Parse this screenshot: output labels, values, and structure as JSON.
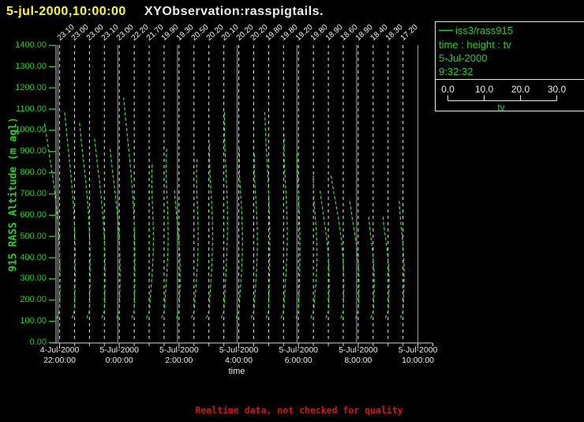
{
  "title": {
    "timestamp": "5-jul-2000,10:00:00",
    "window_name": "XYObservation:rasspigtails."
  },
  "legend": {
    "series_label": "iss3/rass915",
    "fields_label": "time : height : tv",
    "date": "5-Jul-2000",
    "time": "9:32:32",
    "scale": {
      "tick_labels": [
        "0.0",
        "10.0",
        "20.0",
        "30.0"
      ],
      "label": "tv"
    }
  },
  "y_axis": {
    "label": "915 RASS Altitude (m agl)",
    "tick_labels": [
      "1400.00",
      "1300.00",
      "1200.00",
      "1100.00",
      "1000.00",
      "900.00",
      "800.00",
      "700.00",
      "600.00",
      "500.00",
      "400.00",
      "300.00",
      "200.00",
      "100.00",
      "0.00"
    ]
  },
  "x_axis": {
    "label": "time",
    "major_ticks": [
      {
        "date": "4-Jul-2000",
        "time": "22:00:00"
      },
      {
        "date": "5-Jul-2000",
        "time": "0:00:00"
      },
      {
        "date": "5-Jul-2000",
        "time": "2:00:00"
      },
      {
        "date": "5-Jul-2000",
        "time": "4:00:00"
      },
      {
        "date": "5-Jul-2000",
        "time": "6:00:00"
      },
      {
        "date": "5-Jul-2000",
        "time": "8:00:00"
      },
      {
        "date": "5-Jul-2000",
        "time": "10:00:00"
      }
    ]
  },
  "footer": {
    "warning": "Realtime data, not checked for quality"
  },
  "colors": {
    "background": "#000000",
    "title_yellow": "#ffff00",
    "text_white": "#ededed",
    "text_green": "#1fd41f",
    "curve_green": "#33e633",
    "grid_dashed": "#e8e8e8",
    "grid_solid": "#a0a0a0",
    "axis": "#d8d8d8",
    "warning_red": "#e01212"
  },
  "chart_data": {
    "type": "line",
    "title": "RASS virtual temperature pigtail profiles, one per 30 minutes",
    "xlabel": "time",
    "ylabel": "915 RASS Altitude (m agl)",
    "x_range": [
      "4-Jul-2000 22:00:00",
      "5-Jul-2000 10:00:00"
    ],
    "ylim_m": [
      0,
      1400
    ],
    "tv_scale_range": [
      0.0,
      30.0
    ],
    "profile_interval_min": 30,
    "lowest_gate_m": 115,
    "profiles": [
      {
        "time": "22:00",
        "surface_tv": 23.1,
        "top_alt_m": 1050,
        "tv_lean_at_top": -4.3
      },
      {
        "time": "22:30",
        "surface_tv": 23.0,
        "top_alt_m": 1100,
        "tv_lean_at_top": -2.8
      },
      {
        "time": "23:00",
        "surface_tv": 23.0,
        "top_alt_m": 1045,
        "tv_lean_at_top": -2.8
      },
      {
        "time": "23:30",
        "surface_tv": 23.1,
        "top_alt_m": 975,
        "tv_lean_at_top": -2.8
      },
      {
        "time": "0:00",
        "surface_tv": 23.0,
        "top_alt_m": 920,
        "tv_lean_at_top": -2.6
      },
      {
        "time": "0:30",
        "surface_tv": 22.2,
        "top_alt_m": 1165,
        "tv_lean_at_top": -3.0
      },
      {
        "time": "1:00",
        "surface_tv": 21.7,
        "top_alt_m": 865,
        "tv_lean_at_top": 0.9
      },
      {
        "time": "1:30",
        "surface_tv": 19.9,
        "top_alt_m": 915,
        "tv_lean_at_top": 0.7
      },
      {
        "time": "2:00",
        "surface_tv": 19.3,
        "top_alt_m": 730,
        "tv_lean_at_top": -1.3
      },
      {
        "time": "2:30",
        "surface_tv": 20.5,
        "top_alt_m": 880,
        "tv_lean_at_top": 0.9
      },
      {
        "time": "3:00",
        "surface_tv": 20.2,
        "top_alt_m": 960,
        "tv_lean_at_top": 0.2
      },
      {
        "time": "3:30",
        "surface_tv": 20.1,
        "top_alt_m": 1100,
        "tv_lean_at_top": 0.2
      },
      {
        "time": "4:00",
        "surface_tv": 20.2,
        "top_alt_m": 915,
        "tv_lean_at_top": 0.2
      },
      {
        "time": "4:30",
        "surface_tv": 20.2,
        "top_alt_m": 910,
        "tv_lean_at_top": 0.2
      },
      {
        "time": "5:00",
        "surface_tv": 19.8,
        "top_alt_m": 1100,
        "tv_lean_at_top": -1.1
      },
      {
        "time": "5:30",
        "surface_tv": 19.8,
        "top_alt_m": 980,
        "tv_lean_at_top": 0.2
      },
      {
        "time": "6:00",
        "surface_tv": 19.2,
        "top_alt_m": 910,
        "tv_lean_at_top": -0.4
      },
      {
        "time": "6:30",
        "surface_tv": 19.8,
        "top_alt_m": 795,
        "tv_lean_at_top": 0.0
      },
      {
        "time": "7:00",
        "surface_tv": 18.9,
        "top_alt_m": 730,
        "tv_lean_at_top": -2.4
      },
      {
        "time": "7:30",
        "surface_tv": 18.6,
        "top_alt_m": 795,
        "tv_lean_at_top": -3.5
      },
      {
        "time": "8:00",
        "surface_tv": 18.9,
        "top_alt_m": 675,
        "tv_lean_at_top": -2.4
      },
      {
        "time": "8:30",
        "surface_tv": 18.4,
        "top_alt_m": 610,
        "tv_lean_at_top": -1.3
      },
      {
        "time": "9:00",
        "surface_tv": 18.3,
        "top_alt_m": 610,
        "tv_lean_at_top": -1.5
      },
      {
        "time": "9:30",
        "surface_tv": 17.2,
        "top_alt_m": 675,
        "tv_lean_at_top": -1.1
      }
    ]
  }
}
